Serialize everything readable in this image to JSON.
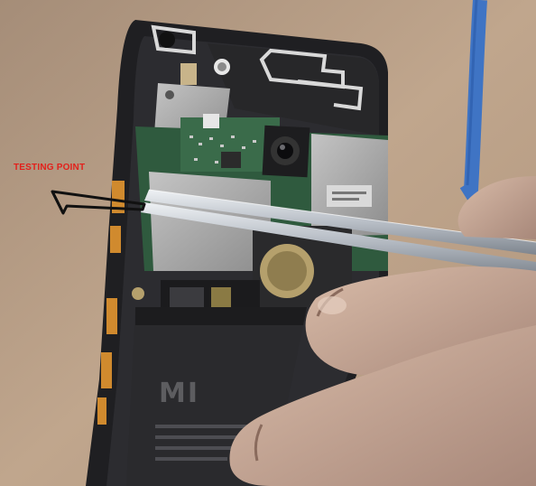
{
  "annotation": {
    "label": "TESTING POINT",
    "color": "#e3201b",
    "arrow_color": "#111111"
  },
  "battery": {
    "logo_text": "MI"
  },
  "colors": {
    "surface": "#b99f86",
    "phone_frame": "#1f1f22",
    "pcb": "#2f5a3e",
    "shield": "#a8a8a8",
    "battery": "#2a2a2d",
    "cable": "#3f74c4",
    "skin": "#c9a995",
    "tweezers": "#c6ccd4"
  }
}
